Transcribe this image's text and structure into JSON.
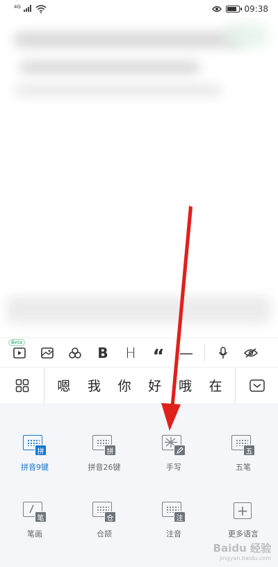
{
  "status_bar": {
    "network_label": "4G",
    "time": "09:38"
  },
  "format_toolbar": {
    "beta_badge": "Beta",
    "bold_label": "B",
    "heading_label": "H",
    "quote_label": "“",
    "divider_label": "—",
    "icons": [
      "video-icon",
      "image-icon",
      "sticker-icon",
      "bold-icon",
      "heading-icon",
      "quote-icon",
      "divider-icon",
      "microphone-icon",
      "hide-keyboard-icon"
    ]
  },
  "candidates": [
    "嗯",
    "我",
    "你",
    "好",
    "哦",
    "在"
  ],
  "keyboard_modes": {
    "row1": [
      {
        "label": "拼音9键",
        "badge": "拼",
        "active": true
      },
      {
        "label": "拼音26键",
        "badge": "拼",
        "active": false
      },
      {
        "label": "手写",
        "badge": "",
        "active": false
      },
      {
        "label": "五笔",
        "badge": "五",
        "active": false
      }
    ],
    "row2": [
      {
        "label": "笔画",
        "badge": "笔",
        "active": false
      },
      {
        "label": "仓颉",
        "badge": "仓",
        "active": false
      },
      {
        "label": "注音",
        "badge": "注",
        "active": false
      },
      {
        "label": "更多语言",
        "badge": "",
        "active": false
      }
    ]
  },
  "watermark": {
    "text": "Baidu 经验",
    "url": "jingyan.baidu.com"
  },
  "colors": {
    "accent": "#1677d2",
    "arrow": "#e0201c",
    "panel_bg": "#f4f6f9"
  }
}
